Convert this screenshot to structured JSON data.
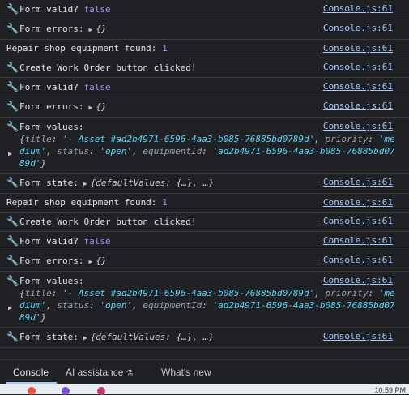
{
  "source": "Console.js:61",
  "entries": [
    {
      "kind": "valid",
      "label": "Form valid?",
      "value": "false"
    },
    {
      "kind": "errors",
      "label": "Form errors:",
      "value": "{}"
    },
    {
      "kind": "found",
      "label": "Repair shop equipment found:",
      "value": "1"
    },
    {
      "kind": "click",
      "label": "Create Work Order button clicked!"
    },
    {
      "kind": "valid",
      "label": "Form valid?",
      "value": "false"
    },
    {
      "kind": "errors",
      "label": "Form errors:",
      "value": "{}"
    },
    {
      "kind": "values",
      "label": "Form values:"
    },
    {
      "kind": "state",
      "label": "Form state:",
      "value": "{defaultValues: {…}, …}"
    },
    {
      "kind": "found",
      "label": "Repair shop equipment found:",
      "value": "1"
    },
    {
      "kind": "click",
      "label": "Create Work Order button clicked!"
    },
    {
      "kind": "valid",
      "label": "Form valid?",
      "value": "false"
    },
    {
      "kind": "errors",
      "label": "Form errors:",
      "value": "{}"
    },
    {
      "kind": "values",
      "label": "Form values:"
    },
    {
      "kind": "state",
      "label": "Form state:",
      "value": "{defaultValues: {…}, …}"
    }
  ],
  "form_values": {
    "title_key": "title",
    "title_value": "'- Asset #ad2b4971-6596-4aa3-b085-76885bd0789d'",
    "priority_key": "priority",
    "priority_value": "'medium'",
    "status_key": "status",
    "status_value": "'open'",
    "equipment_key": "equipmentId",
    "equipment_value": "'ad2b4971-6596-4aa3-b085-76885bd0789d'"
  },
  "drawer": {
    "tabs": [
      "Console",
      "AI assistance",
      "What's new"
    ],
    "active": "Console"
  },
  "taskbar": {
    "clock": "10:59 PM"
  }
}
